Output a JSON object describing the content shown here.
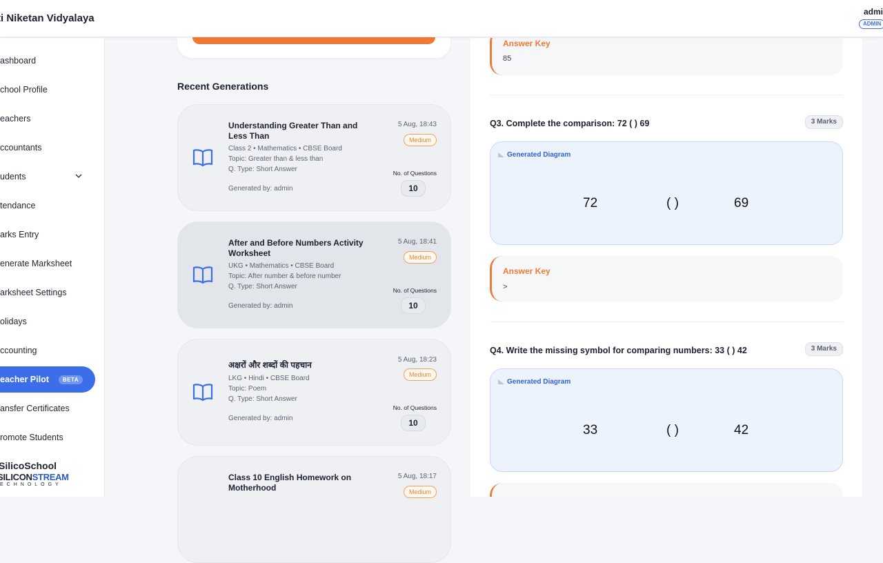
{
  "header": {
    "school_name": "ti Niketan Vidyalaya",
    "user_name": "admi",
    "role": "ADMIN"
  },
  "sidebar": {
    "items": [
      {
        "label": "ashboard"
      },
      {
        "label": "chool Profile"
      },
      {
        "label": "eachers"
      },
      {
        "label": "ccountants"
      },
      {
        "label": "udents",
        "has_chevron": true
      },
      {
        "label": "tendance"
      },
      {
        "label": "arks Entry"
      },
      {
        "label": "enerate Marksheet"
      },
      {
        "label": "arksheet Settings"
      },
      {
        "label": "olidays"
      },
      {
        "label": "ccounting"
      },
      {
        "label": "eacher Pilot",
        "active": true,
        "badge": "BETA"
      },
      {
        "label": "ansfer Certificates"
      },
      {
        "label": "romote Students"
      }
    ],
    "brand": {
      "line1": "SilicoSchool",
      "line2a": "SILICON",
      "line2b": "STREAM",
      "line3": "ECHNOLOGY"
    }
  },
  "recent": {
    "title": "Recent Generations",
    "nq_label": "No. of Questions",
    "cards": [
      {
        "title": "Understanding Greater Than and Less Than",
        "meta": "Class 2 • Mathematics • CBSE Board",
        "topic": "Topic: Greater than & less than",
        "qtype": "Q. Type: Short Answer",
        "generated_by": "Generated by: admin",
        "time": "5 Aug, 18:43",
        "difficulty": "Medium",
        "num_questions": "10"
      },
      {
        "title": "After and Before Numbers Activity Worksheet",
        "meta": "UKG • Mathematics • CBSE Board",
        "topic": "Topic: After number & before number",
        "qtype": "Q. Type: Short Answer",
        "generated_by": "Generated by: admin",
        "time": "5 Aug, 18:41",
        "difficulty": "Medium",
        "num_questions": "10"
      },
      {
        "title": "अक्षरों और शब्दों की पहचान",
        "meta": "LKG • Hindi • CBSE Board",
        "topic": "Topic: Poem",
        "qtype": "Q. Type: Short Answer",
        "generated_by": "Generated by: admin",
        "time": "5 Aug, 18:23",
        "difficulty": "Medium",
        "num_questions": "10"
      },
      {
        "title": "Class 10 English Homework on Motherhood",
        "time": "5 Aug, 18:17",
        "difficulty": "Medium"
      }
    ]
  },
  "detail": {
    "answer_key_label": "Answer Key",
    "diagram_label": "Generated Diagram",
    "prev_answer": "85",
    "questions": [
      {
        "title": "Q3. Complete the comparison: 72 ( ) 69",
        "marks": "3 Marks",
        "diagram": [
          "72",
          "( )",
          "69"
        ],
        "answer": ">"
      },
      {
        "title": "Q4. Write the missing symbol for comparing numbers: 33 ( ) 42",
        "marks": "3 Marks",
        "diagram": [
          "33",
          "( )",
          "42"
        ]
      }
    ]
  },
  "colors": {
    "accent": "#3b6ee8",
    "orange": "#f07a35"
  }
}
